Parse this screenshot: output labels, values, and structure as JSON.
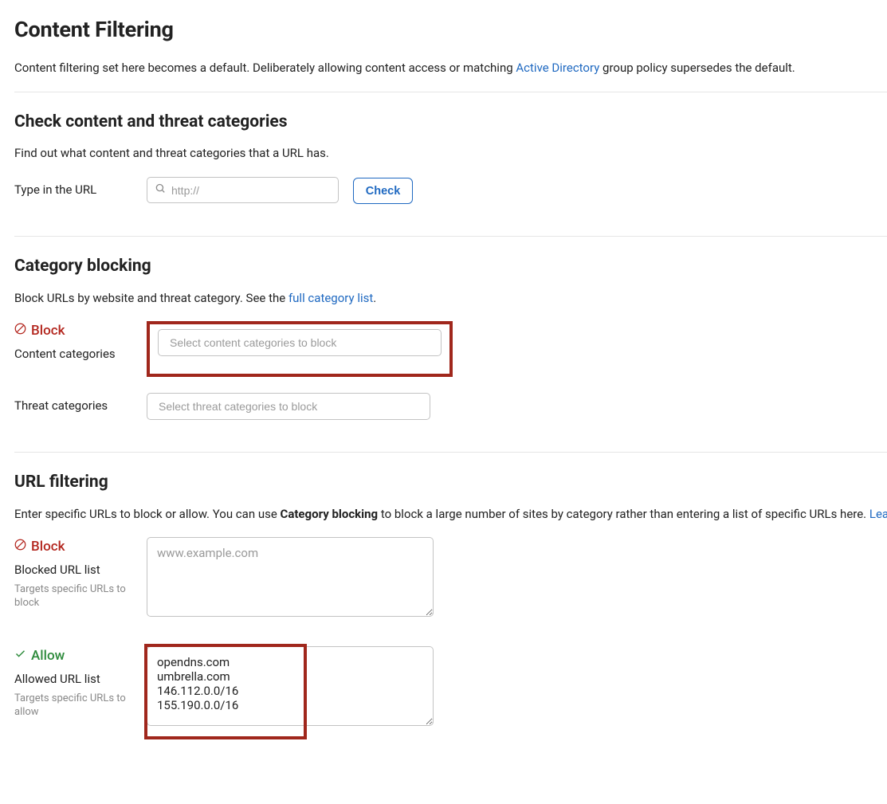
{
  "header": {
    "title": "Content Filtering",
    "intro_pre": "Content filtering set here becomes a default. Deliberately allowing content access or matching ",
    "intro_link": "Active Directory",
    "intro_post": " group policy supersedes the default."
  },
  "checkCategories": {
    "title": "Check content and threat categories",
    "desc": "Find out what content and threat categories that a URL has.",
    "label": "Type in the URL",
    "placeholder": "http://",
    "button": "Check"
  },
  "categoryBlocking": {
    "title": "Category blocking",
    "desc_pre": "Block URLs by website and threat category. See the",
    "desc_link": "full category list",
    "desc_post": ".",
    "blockTag": "Block",
    "contentLabel": "Content categories",
    "contentPlaceholder": "Select content categories to block",
    "threatLabel": "Threat categories",
    "threatPlaceholder": "Select threat categories to block"
  },
  "urlFiltering": {
    "title": "URL filtering",
    "desc_pre": "Enter specific URLs to block or allow. You can use ",
    "desc_bold": "Category blocking",
    "desc_mid": " to block a large number of sites by category rather than entering a list of specific URLs here.",
    "desc_link": "Lea",
    "blockTag": "Block",
    "blockedLabel": "Blocked URL list",
    "blockedHelp": "Targets specific URLs to block",
    "blockedPlaceholder": "www.example.com",
    "allowTag": "Allow",
    "allowedLabel": "Allowed URL list",
    "allowedHelp": "Targets specific URLs to allow",
    "allowedValue": "opendns.com\numbrella.com\n146.112.0.0/16\n155.190.0.0/16"
  }
}
